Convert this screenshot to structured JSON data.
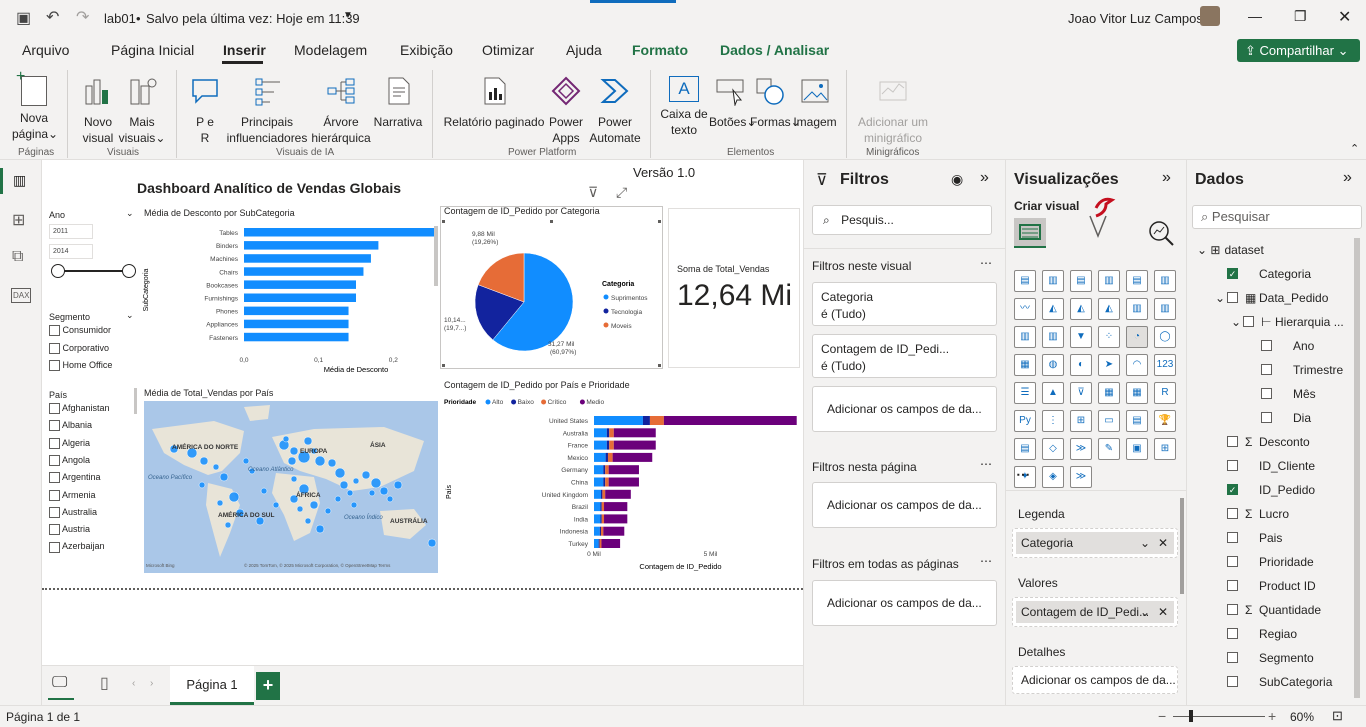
{
  "titlebar": {
    "file": "lab01",
    "saved": "Salvo pela última vez: Hoje em 11:39",
    "user": "Joao Vitor Luz Campos"
  },
  "menu": {
    "items": [
      "Arquivo",
      "Página Inicial",
      "Inserir",
      "Modelagem",
      "Exibição",
      "Otimizar",
      "Ajuda",
      "Formato",
      "Dados / Analisar"
    ],
    "share": "Compartilhar"
  },
  "ribbon": {
    "nova_pagina_1": "Nova",
    "nova_pagina_2": "página",
    "novo_visual_1": "Novo",
    "novo_visual_2": "visual",
    "mais_visuais_1": "Mais",
    "mais_visuais_2": "visuais",
    "pr_1": "P e",
    "pr_2": "R",
    "principais_1": "Principais",
    "principais_2": "influenciadores",
    "arvore_1": "Árvore",
    "arvore_2": "hierárquica",
    "narrativa": "Narrativa",
    "relatorio": "Relatório paginado",
    "powerapps_1": "Power",
    "powerapps_2": "Apps",
    "automate_1": "Power",
    "automate_2": "Automate",
    "caixa_1": "Caixa de",
    "caixa_2": "texto",
    "botoes": "Botões",
    "formas": "Formas",
    "imagem": "Imagem",
    "mini_1": "Adicionar um",
    "mini_2": "minigráfico",
    "groups": [
      "Páginas",
      "Visuais",
      "Visuais de IA",
      "Power Platform",
      "Elementos",
      "Minigráficos"
    ]
  },
  "canvas": {
    "title": "Dashboard Analítico de Vendas Globais",
    "version": "Versão 1.0",
    "ano_label": "Ano",
    "ano_from": "2011",
    "ano_to": "2014",
    "segmento_label": "Segmento",
    "segmentos": [
      "Consumidor",
      "Corporativo",
      "Home Office"
    ],
    "pais_label": "País",
    "paises": [
      "Afghanistan",
      "Albania",
      "Algeria",
      "Angola",
      "Argentina",
      "Armenia",
      "Australia",
      "Austria",
      "Azerbaijan"
    ],
    "card_label": "Soma de Total_Vendas",
    "card_value": "12,64 Mi",
    "map_title": "Média de Total_Vendas por País",
    "map_labels": [
      "AMÉRICA DO NORTE",
      "EUROPA",
      "ÁSIA",
      "Oceano Atlântico",
      "ÁFRICA",
      "AMÉRICA DO SUL",
      "Oceano Índico",
      "AUSTRÁLIA",
      "Oceano Pacífico"
    ],
    "map_credit": "© 2025 TomTom, © 2025 Microsoft Corporation, © OpenStreetMap  Terms",
    "map_brand": "Microsoft Bing"
  },
  "chart_data": [
    {
      "type": "bar",
      "title": "Média de Desconto por SubCategoria",
      "xlabel": "Média de Desconto",
      "ylabel": "SubCategoria",
      "categories": [
        "Tables",
        "Binders",
        "Machines",
        "Chairs",
        "Bookcases",
        "Furnishings",
        "Phones",
        "Appliances",
        "Fasteners"
      ],
      "values": [
        0.29,
        0.18,
        0.17,
        0.16,
        0.15,
        0.15,
        0.14,
        0.14,
        0.14
      ],
      "xlim": [
        0,
        0.3
      ],
      "xticks": [
        "0,0",
        "0,1",
        "0,2",
        "0,3"
      ]
    },
    {
      "type": "pie",
      "title": "Contagem de ID_Pedido por Categoria",
      "legend_title": "Categoria",
      "categories": [
        "Suprimentos",
        "Tecnologia",
        "Moveis"
      ],
      "values": [
        31.27,
        10.14,
        9.88
      ],
      "colors": [
        "#118DFF",
        "#12239E",
        "#E66C37"
      ],
      "labels": [
        "31,27 Mil (60,97%)",
        "10,14... (19,7...)",
        "9,88 Mil (19,26%)"
      ]
    },
    {
      "type": "bar",
      "title": "Contagem de ID_Pedido por País e Prioridade",
      "legend_title": "Prioridade",
      "xlabel": "Contagem de ID_Pedido",
      "ylabel": "País",
      "categories": [
        "United States",
        "Australia",
        "France",
        "Mexico",
        "Germany",
        "China",
        "United Kingdom",
        "Brazil",
        "India",
        "Indonesia",
        "Turkey"
      ],
      "series": [
        {
          "name": "Alto",
          "color": "#118DFF",
          "values": [
            2.1,
            0.55,
            0.55,
            0.5,
            0.4,
            0.4,
            0.3,
            0.28,
            0.28,
            0.25,
            0.2
          ]
        },
        {
          "name": "Baixo",
          "color": "#12239E",
          "values": [
            0.3,
            0.1,
            0.1,
            0.1,
            0.08,
            0.08,
            0.06,
            0.05,
            0.05,
            0.05,
            0.04
          ]
        },
        {
          "name": "Crítico",
          "color": "#E66C37",
          "values": [
            0.6,
            0.2,
            0.2,
            0.2,
            0.15,
            0.15,
            0.12,
            0.1,
            0.1,
            0.1,
            0.08
          ]
        },
        {
          "name": "Medio",
          "color": "#6B007B",
          "values": [
            5.7,
            1.8,
            1.8,
            1.7,
            1.3,
            1.3,
            1.1,
            1.0,
            1.0,
            0.9,
            0.8
          ]
        }
      ],
      "xlim": [
        0,
        10
      ],
      "xticks": [
        "0 Mil",
        "5 Mil",
        "10 Mil"
      ]
    }
  ],
  "pages": {
    "tab": "Página 1",
    "status": "Página 1 de 1",
    "zoom": "60%"
  },
  "filters": {
    "title": "Filtros",
    "search": "Pesquis...",
    "this_visual": "Filtros neste visual",
    "f1_name": "Categoria",
    "f1_val": "é (Tudo)",
    "f2_name": "Contagem de ID_Pedi...",
    "f2_val": "é (Tudo)",
    "add": "Adicionar os campos de da...",
    "this_page": "Filtros nesta página",
    "all_pages": "Filtros em todas as páginas"
  },
  "viz": {
    "title": "Visualizações",
    "create": "Criar visual",
    "legenda": "Legenda",
    "legenda_field": "Categoria",
    "valores": "Valores",
    "valores_field": "Contagem de ID_Pedi...",
    "detalhes": "Detalhes",
    "detalhes_add": "Adicionar os campos de da..."
  },
  "data": {
    "title": "Dados",
    "search": "Pesquisar",
    "items": [
      {
        "label": "dataset",
        "lvl": 0,
        "chk": null
      },
      {
        "label": "Categoria",
        "lvl": 1,
        "chk": true
      },
      {
        "label": "Data_Pedido",
        "lvl": 1,
        "chk": false
      },
      {
        "label": "Hierarquia ...",
        "lvl": 2,
        "chk": false
      },
      {
        "label": "Ano",
        "lvl": 3,
        "chk": false
      },
      {
        "label": "Trimestre",
        "lvl": 3,
        "chk": false
      },
      {
        "label": "Mês",
        "lvl": 3,
        "chk": false
      },
      {
        "label": "Dia",
        "lvl": 3,
        "chk": false
      },
      {
        "label": "Desconto",
        "lvl": 1,
        "chk": false,
        "sigma": true
      },
      {
        "label": "ID_Cliente",
        "lvl": 1,
        "chk": false
      },
      {
        "label": "ID_Pedido",
        "lvl": 1,
        "chk": true
      },
      {
        "label": "Lucro",
        "lvl": 1,
        "chk": false,
        "sigma": true
      },
      {
        "label": "Pais",
        "lvl": 1,
        "chk": false
      },
      {
        "label": "Prioridade",
        "lvl": 1,
        "chk": false
      },
      {
        "label": "Product ID",
        "lvl": 1,
        "chk": false
      },
      {
        "label": "Quantidade",
        "lvl": 1,
        "chk": false,
        "sigma": true
      },
      {
        "label": "Regiao",
        "lvl": 1,
        "chk": false
      },
      {
        "label": "Segmento",
        "lvl": 1,
        "chk": false
      },
      {
        "label": "SubCategoria",
        "lvl": 1,
        "chk": false
      }
    ]
  }
}
